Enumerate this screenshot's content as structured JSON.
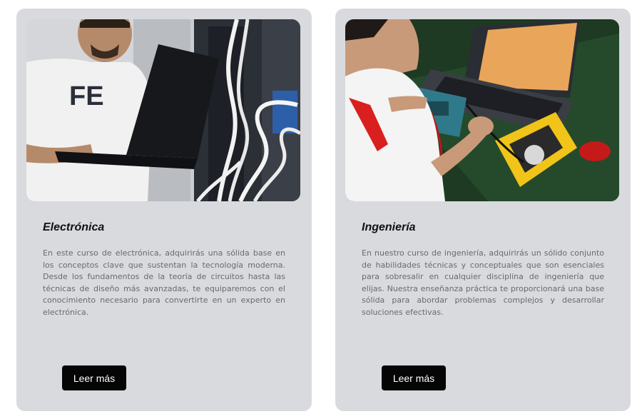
{
  "courses": [
    {
      "image": "technician-with-laptop-at-server-rack",
      "title": "Electrónica",
      "description": "En este curso de electrónica, adquirirás una sólida base en los conceptos clave que sustentan la tecnología moderna. Desde los fundamentos de la teoría de circuitos hasta las técnicas de diseño más avanzadas, te equiparemos con el conocimiento necesario para convertirte en un experto en electrónica.",
      "button_label": "Leer más"
    },
    {
      "image": "engineer-testing-circuit-board-with-multimeter",
      "title": "Ingeniería",
      "description": "En nuestro curso de ingeniería, adquirirás un sólido conjunto de habilidades técnicas y conceptuales que son esenciales para sobresalir en cualquier disciplina de ingeniería que elijas. Nuestra enseñanza práctica te proporcionará una base sólida para abordar problemas complejos y desarrollar soluciones efectivas.",
      "button_label": "Leer más"
    }
  ],
  "colors": {
    "card_background": "#d9dade",
    "button_background": "#050505",
    "button_text": "#ffffff",
    "description_text": "#6a6a6a"
  }
}
